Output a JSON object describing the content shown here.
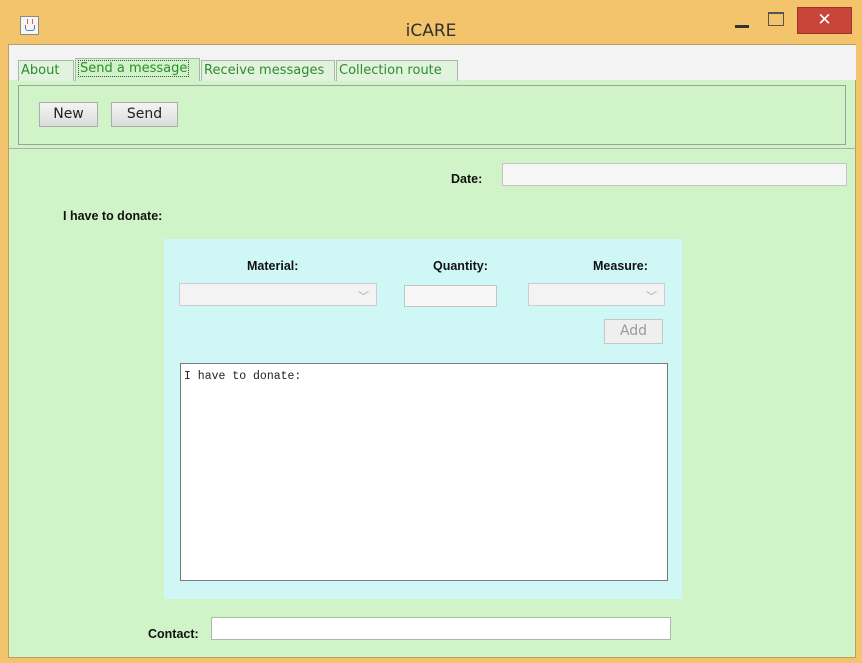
{
  "window": {
    "title": "iCARE",
    "minimize_label": "",
    "close_label": "✕"
  },
  "tabs": [
    {
      "label": "About"
    },
    {
      "label": "Send a message"
    },
    {
      "label": "Receive messages"
    },
    {
      "label": "Collection route"
    }
  ],
  "toolbar": {
    "new_label": "New",
    "send_label": "Send"
  },
  "form": {
    "date_label": "Date:",
    "date_value": "",
    "donate_label": "I have to donate:",
    "material_label": "Material:",
    "quantity_label": "Quantity:",
    "measure_label": "Measure:",
    "material_value": "",
    "quantity_value": "",
    "measure_value": "",
    "add_label": "Add",
    "message_text": "I have to donate:",
    "contact_label": "Contact:",
    "contact_value": ""
  },
  "icons": {
    "app": "java-coffee-cup-icon",
    "combo_arrow": "chevron-down-icon"
  },
  "colors": {
    "titlebar": "#f3c46c",
    "panel_bg": "#d0f4c8",
    "inner_panel": "#cef7f6",
    "tab_text": "#2e8b2e",
    "close_button": "#c8453a"
  }
}
